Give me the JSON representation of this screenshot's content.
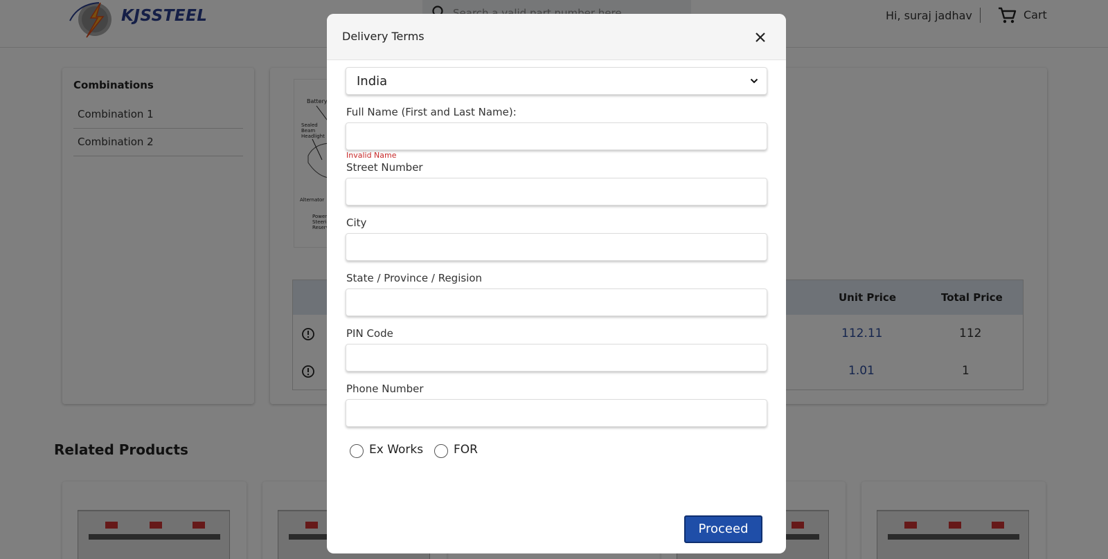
{
  "header": {
    "brand": "KJSSTEEL",
    "search_placeholder": "Search a valid part number here",
    "greeting": "Hi, suraj jadhav",
    "cart_label": "Cart"
  },
  "sidebar": {
    "title": "Combinations",
    "items": [
      {
        "label": "Combination 1"
      },
      {
        "label": "Combination 2"
      }
    ]
  },
  "product": {
    "diagram_labels": [
      "Battery",
      "Sealed Beam Headlight",
      "Alternator",
      "Power Steering Reservoir"
    ],
    "table": {
      "headers": {
        "unit_price": "Unit Price",
        "total_price": "Total Price"
      },
      "rows": [
        {
          "unit_price": "112.11",
          "total_price": "112"
        },
        {
          "unit_price": "1.01",
          "total_price": "1"
        }
      ]
    }
  },
  "related": {
    "title": "Related Products"
  },
  "modal": {
    "title": "Delivery Terms",
    "country": "India",
    "fields": {
      "full_name": {
        "label": "Full Name (First and Last Name):",
        "value": "",
        "error": "Invalid Name"
      },
      "street": {
        "label": "Street Number",
        "value": ""
      },
      "city": {
        "label": "City",
        "value": ""
      },
      "state": {
        "label": "State / Province / Regision",
        "value": ""
      },
      "pin": {
        "label": "PIN Code",
        "value": ""
      },
      "phone": {
        "label": "Phone Number",
        "value": ""
      }
    },
    "radios": [
      {
        "label": "Ex Works",
        "checked": false
      },
      {
        "label": "FOR",
        "checked": false
      }
    ],
    "proceed_label": "Proceed"
  },
  "colors": {
    "brand": "#2b3f8f",
    "primary_button": "#1f4ea8",
    "error": "#c62828",
    "table_header": "#dce4ef",
    "price_link": "#2b4a9b"
  },
  "icons": [
    "logo-emblem",
    "search-icon",
    "cart-icon",
    "info-icon",
    "close-icon",
    "chevron-down-icon"
  ]
}
